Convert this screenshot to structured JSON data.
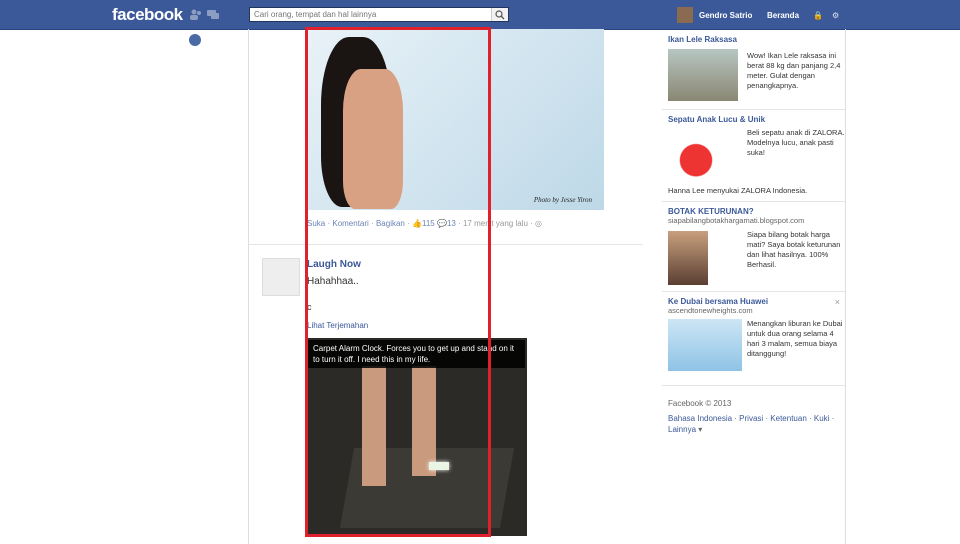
{
  "topbar": {
    "logo": "facebook",
    "search_placeholder": "Cari orang, tempat dan hal lainnya",
    "user_name": "Gendro Satrio",
    "home": "Beranda"
  },
  "post1": {
    "watermark": "Photo by Jesse Yiron",
    "like": "Suka",
    "comment": "Komentari",
    "share": "Bagikan",
    "like_count": "115",
    "comment_count": "13",
    "time": "17 menit yang lalu"
  },
  "post2": {
    "page_name": "Laugh Now",
    "text": "Hahahhaa..",
    "extra": "c",
    "translate": "Lihat Terjemahan",
    "caption": "Carpet Alarm Clock. Forces you to get up and stand on it to turn it off. I need this in my life."
  },
  "ads": [
    {
      "title": "Ikan Lele Raksasa",
      "url": "",
      "text": "Wow! Ikan Lele raksasa ini berat 88 kg dan panjang 2,4 meter. Gulat dengan penangkapnya.",
      "social": ""
    },
    {
      "title": "Sepatu Anak Lucu & Unik",
      "url": "",
      "text": "Beli sepatu anak di ZALORA. Modelnya lucu, anak pasti suka!",
      "social": "Hanna Lee menyukai ZALORA Indonesia."
    },
    {
      "title": "BOTAK KETURUNAN?",
      "url": "siapabilangbotakhargamati.blogspot.com",
      "text": "Siapa bilang botak harga mati? Saya botak keturunan dan lihat hasilnya. 100% Berhasil.",
      "social": ""
    },
    {
      "title": "Ke Dubai bersama Huawei",
      "url": "ascendtonewheights.com",
      "text": "Menangkan liburan ke Dubai untuk dua orang selama 4 hari 3 malam, semua biaya ditanggung!",
      "social": ""
    }
  ],
  "footer": {
    "copyright": "Facebook © 2013",
    "links": [
      "Bahasa Indonesia",
      "Privasi",
      "Ketentuan",
      "Kuki",
      "Lainnya"
    ]
  },
  "colors": {
    "brand": "#3b5998",
    "highlight": "#e0202a"
  }
}
